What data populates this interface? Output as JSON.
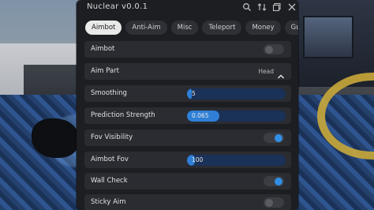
{
  "window": {
    "title": "Nuclear v0.0.1",
    "icons": [
      "search-icon",
      "sort-icon",
      "minimize-icon",
      "close-icon"
    ]
  },
  "tabs": [
    {
      "label": "Aimbot",
      "active": true
    },
    {
      "label": "Anti-Aim",
      "active": false
    },
    {
      "label": "Misc",
      "active": false
    },
    {
      "label": "Teleport",
      "active": false
    },
    {
      "label": "Money",
      "active": false
    },
    {
      "label": "Gun I",
      "active": false
    }
  ],
  "settings": {
    "aimbot": {
      "label": "Aimbot",
      "enabled": false
    },
    "aim_part": {
      "label": "Aim Part",
      "value": "Head"
    },
    "smoothing": {
      "label": "Smoothing",
      "value": "5",
      "fill_fraction": 0.05
    },
    "prediction_strength": {
      "label": "Prediction Strength",
      "value": "0.065",
      "fill_fraction": 0.33
    },
    "fov_visibility": {
      "label": "Fov Visibility",
      "enabled": true
    },
    "aimbot_fov": {
      "label": "Aimbot Fov",
      "value": "100",
      "fill_fraction": 0.08
    },
    "wall_check": {
      "label": "Wall Check",
      "enabled": true
    },
    "sticky_aim": {
      "label": "Sticky Aim",
      "enabled": false
    }
  },
  "colors": {
    "panel": "#1d1e22",
    "row": "#2a2c31",
    "accent": "#2f8fe6",
    "slider_track": "#1a3158"
  }
}
